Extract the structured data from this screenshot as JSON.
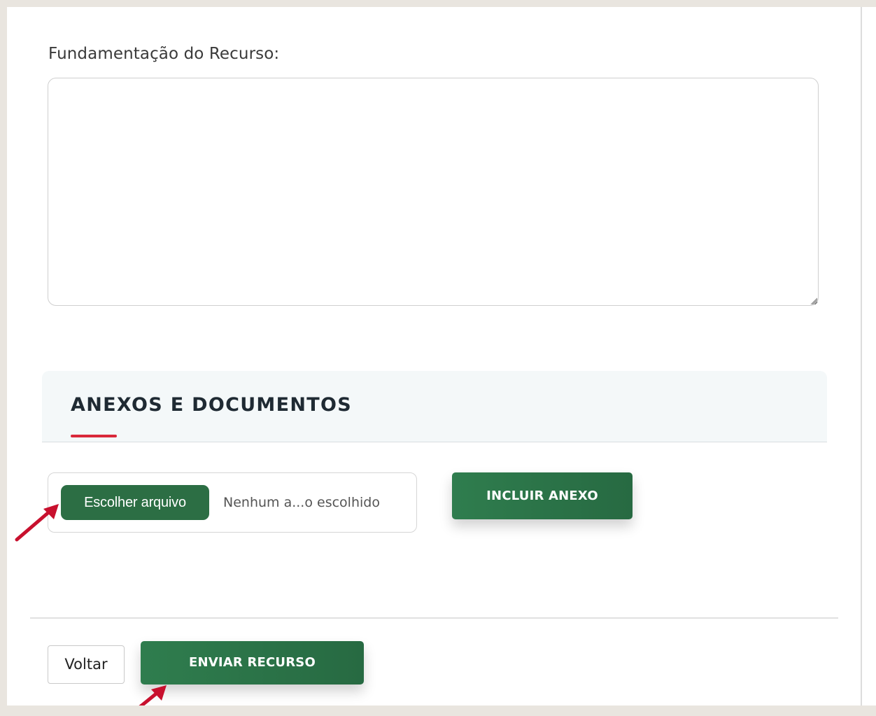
{
  "form": {
    "label": "Fundamentação do Recurso:",
    "textarea_value": ""
  },
  "attachments": {
    "section_title": "ANEXOS E DOCUMENTOS",
    "choose_file_label": "Escolher arquivo",
    "no_file_text": "Nenhum a...o escolhido",
    "include_button_label": "INCLUIR ANEXO"
  },
  "footer": {
    "back_label": "Voltar",
    "send_label": "ENVIAR RECURSO"
  },
  "colors": {
    "primary_green": "#2c6e44",
    "accent_red": "#d9283a",
    "annotation_arrow": "#c8102e"
  },
  "annotations": {
    "arrow_icon_1": "annotation-arrow-icon",
    "arrow_icon_2": "annotation-arrow-icon"
  }
}
